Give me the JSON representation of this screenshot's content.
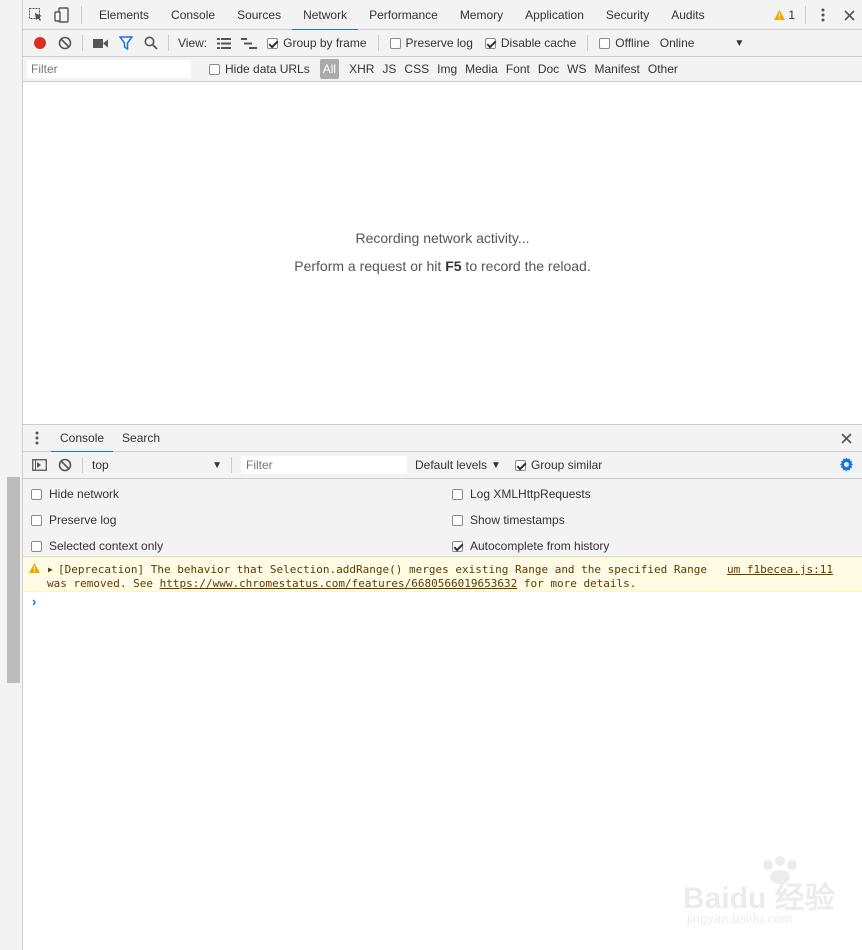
{
  "main_tabs": [
    "Elements",
    "Console",
    "Sources",
    "Network",
    "Performance",
    "Memory",
    "Application",
    "Security",
    "Audits"
  ],
  "active_main_tab": "Network",
  "warnings_count": "1",
  "network_toolbar": {
    "view_label": "View:",
    "group_by_frame": "Group by frame",
    "preserve_log": "Preserve log",
    "disable_cache": "Disable cache",
    "offline": "Offline",
    "throttling": "Online"
  },
  "filter_bar": {
    "filter_placeholder": "Filter",
    "hide_data_urls": "Hide data URLs",
    "types": [
      "All",
      "XHR",
      "JS",
      "CSS",
      "Img",
      "Media",
      "Font",
      "Doc",
      "WS",
      "Manifest",
      "Other"
    ]
  },
  "recording": {
    "line1": "Recording network activity...",
    "line2_prefix": "Perform a request or hit ",
    "line2_key": "F5",
    "line2_suffix": " to record the reload."
  },
  "drawer": {
    "tabs": [
      "Console",
      "Search"
    ],
    "context": "top",
    "filter_placeholder": "Filter",
    "levels": "Default levels",
    "group_similar": "Group similar",
    "settings": {
      "hide_network": "Hide network",
      "preserve_log": "Preserve log",
      "selected_context_only": "Selected context only",
      "log_xhr": "Log XMLHttpRequests",
      "show_timestamps": "Show timestamps",
      "autocomplete": "Autocomplete from history"
    }
  },
  "console_message": {
    "line1": "[Deprecation] The behavior that Selection.addRange() merges existing Range and the specified Range",
    "line2_prefix": "was removed. See ",
    "link": "https://www.chromestatus.com/features/6680566019653632",
    "line2_suffix": " for more details.",
    "source": "um f1becea.js:11"
  },
  "watermark": {
    "brand": "Baidu 经验",
    "url": "jingyan.baidu.com"
  },
  "colors": {
    "accent": "#1a73e8",
    "record": "#d93025",
    "warning_bg": "#fffbe5",
    "toolbar_bg": "#f3f3f3"
  }
}
